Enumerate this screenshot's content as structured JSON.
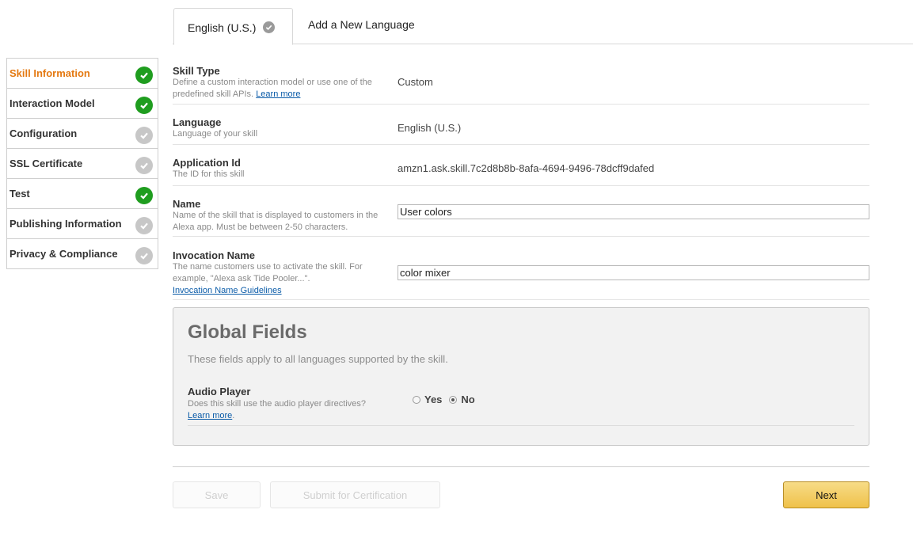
{
  "tabs": [
    {
      "label": "English (U.S.)",
      "active": true,
      "icon": "check-circle-icon"
    },
    {
      "label": "Add a New Language",
      "active": false
    }
  ],
  "sidebar": {
    "items": [
      {
        "label": "Skill Information",
        "status": "complete",
        "active": true
      },
      {
        "label": "Interaction Model",
        "status": "complete",
        "active": false
      },
      {
        "label": "Configuration",
        "status": "incomplete",
        "active": false
      },
      {
        "label": "SSL Certificate",
        "status": "incomplete",
        "active": false
      },
      {
        "label": "Test",
        "status": "complete",
        "active": false
      },
      {
        "label": "Publishing Information",
        "status": "incomplete",
        "active": false
      },
      {
        "label": "Privacy & Compliance",
        "status": "incomplete",
        "active": false
      }
    ]
  },
  "form": {
    "skill_type": {
      "label": "Skill Type",
      "desc": "Define a custom interaction model or use one of the predefined skill APIs.",
      "link": "Learn more",
      "value": "Custom"
    },
    "language": {
      "label": "Language",
      "desc": "Language of your skill",
      "value": "English (U.S.)"
    },
    "application_id": {
      "label": "Application Id",
      "desc": "The ID for this skill",
      "value": "amzn1.ask.skill.7c2d8b8b-8afa-4694-9496-78dcff9dafed"
    },
    "name": {
      "label": "Name",
      "desc": "Name of the skill that is displayed to customers in the Alexa app. Must be between 2-50 characters.",
      "value": "User colors"
    },
    "invocation": {
      "label": "Invocation Name",
      "desc": "The name customers use to activate the skill. For example, \"Alexa ask Tide Pooler...\".",
      "link": "Invocation Name Guidelines",
      "value": "color mixer"
    }
  },
  "global": {
    "title": "Global Fields",
    "desc": "These fields apply to all languages supported by the skill.",
    "audio_player": {
      "label": "Audio Player",
      "desc": "Does this skill use the audio player directives?",
      "link": "Learn more",
      "options": [
        "Yes",
        "No"
      ],
      "selected": "No"
    }
  },
  "buttons": {
    "save": "Save",
    "submit": "Submit for Certification",
    "next": "Next"
  },
  "colors": {
    "accent": "#e47911",
    "complete": "#1f9d1f",
    "incomplete": "#c7c7c7",
    "link": "#0a5ba8",
    "primary_button": "#efc14a"
  }
}
